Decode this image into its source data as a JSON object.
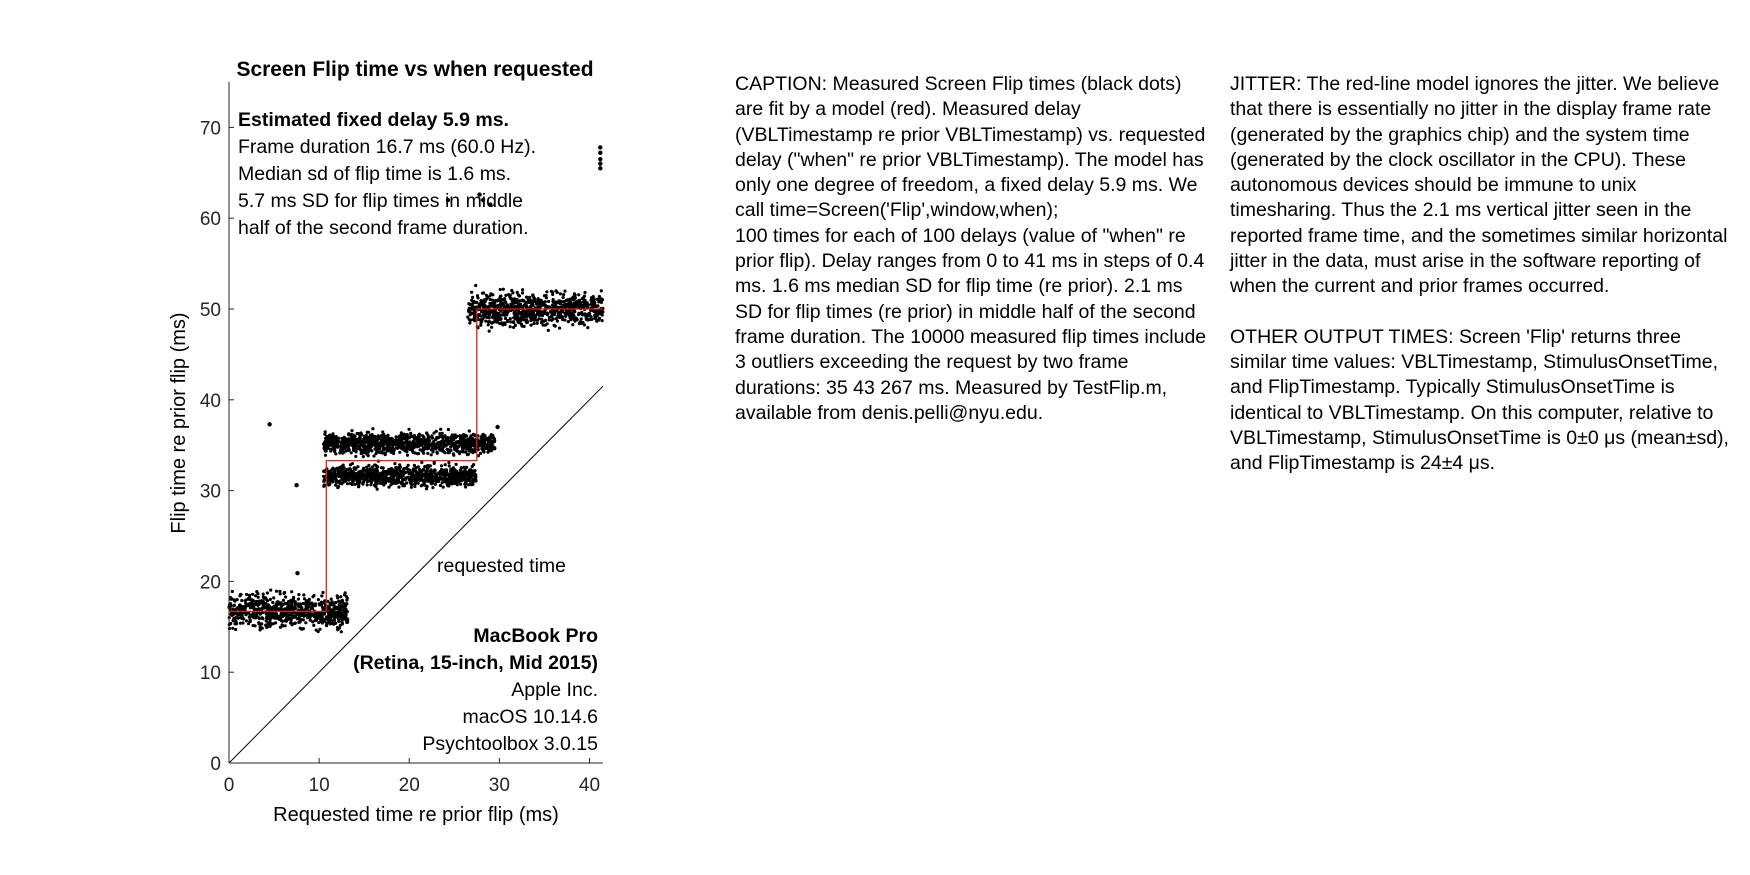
{
  "chart_data": {
    "type": "scatter",
    "title": "Screen Flip time vs when requested",
    "xlabel": "Requested time re prior flip (ms)",
    "ylabel": "Flip time re prior flip (ms)",
    "xlim": [
      0,
      41.5
    ],
    "ylim": [
      0,
      75
    ],
    "xticks": [
      0,
      10,
      20,
      30,
      40
    ],
    "yticks": [
      0,
      10,
      20,
      30,
      40,
      50,
      60,
      70
    ],
    "grid": false,
    "annotations": {
      "stats_title": "Estimated fixed delay 5.9 ms.",
      "stats_lines": [
        "Frame duration 16.7 ms (60.0 Hz).",
        "Median sd of flip time is 1.6 ms.",
        "5.7 ms SD for flip times in middle",
        "half of the second frame duration."
      ],
      "requested_label": "requested time",
      "machine_lines": [
        "MacBook Pro",
        "(Retina, 15-inch, Mid 2015)"
      ],
      "info_lines": [
        "Apple Inc.",
        "macOS 10.14.6",
        "Psychtoolbox 3.0.15"
      ]
    },
    "series": [
      {
        "marker_color": "#000000",
        "clusters": [
          {
            "x_range": [
              0,
              13.2
            ],
            "y_center": 16.7,
            "y_spread": 1.6
          },
          {
            "x_range": [
              10.5,
              29.5
            ],
            "y_center": 35.2,
            "y_spread": 1.0
          },
          {
            "x_range": [
              10.5,
              27.5
            ],
            "y_center": 31.6,
            "y_spread": 1.0
          },
          {
            "x_range": [
              26.5,
              41.5
            ],
            "y_center": 50.0,
            "y_spread": 1.6
          }
        ],
        "outliers": [
          {
            "x": 4.5,
            "y": 37.3
          },
          {
            "x": 7.5,
            "y": 30.6
          },
          {
            "x": 7.6,
            "y": 20.9
          },
          {
            "x": 24.3,
            "y": 62.0
          },
          {
            "x": 27.8,
            "y": 62.6
          },
          {
            "x": 28.2,
            "y": 62.0
          },
          {
            "x": 29.0,
            "y": 61.5
          },
          {
            "x": 29.8,
            "y": 37.0
          },
          {
            "x": 41.2,
            "y": 65.5
          },
          {
            "x": 41.2,
            "y": 66.0
          },
          {
            "x": 41.2,
            "y": 66.5
          },
          {
            "x": 41.2,
            "y": 67.2
          },
          {
            "x": 41.2,
            "y": 67.8
          }
        ]
      },
      {
        "line_color": "#e0201b",
        "model_steps": [
          {
            "x_from": 0,
            "x_to": 10.8,
            "y": 16.7
          },
          {
            "x_from": 10.8,
            "x_to": 27.5,
            "y": 33.3
          },
          {
            "x_from": 27.5,
            "x_to": 41.5,
            "y": 50.0
          }
        ]
      }
    ],
    "reference_line": {
      "y_equals_x": true,
      "color": "#000000"
    }
  },
  "caption_left": {
    "paragraphs": [
      "CAPTION: Measured Screen Flip times (black dots) are fit by a model (red). Measured delay (VBLTimestamp re prior VBLTimestamp) vs. requested delay (\"when\" re prior VBLTimestamp). The model has only one degree of freedom, a fixed delay 5.9 ms. We call time=Screen('Flip',window,when);",
      "100 times for each of 100 delays (value of \"when\" re prior flip). Delay ranges from 0 to 41 ms in steps of 0.4 ms. 1.6 ms median SD for flip time (re prior). 2.1 ms SD for flip times (re prior) in middle half of the second frame duration. The 10000 measured flip times include 3 outliers exceeding the request by two frame durations: 35 43 267  ms. Measured by TestFlip.m, available from denis.pelli@nyu.edu."
    ]
  },
  "caption_right": {
    "jitter": "JITTER: The red-line model ignores the jitter. We believe that there is essentially no jitter in the display frame rate (generated by the graphics chip) and the system time (generated by the clock oscillator in the CPU). These autonomous devices should be immune to unix timesharing. Thus the 2.1 ms vertical jitter seen in the reported frame time, and the sometimes similar horizontal jitter in the data, must arise in the software reporting of when the current and prior frames occurred.",
    "other": "OTHER OUTPUT TIMES: Screen 'Flip' returns three similar time values: VBLTimestamp, StimulusOnsetTime, and FlipTimestamp. Typically StimulusOnsetTime is identical to VBLTimestamp. On this computer, relative to VBLTimestamp, StimulusOnsetTime is 0±0 μs (mean±sd), and FlipTimestamp is 24±4 μs."
  }
}
